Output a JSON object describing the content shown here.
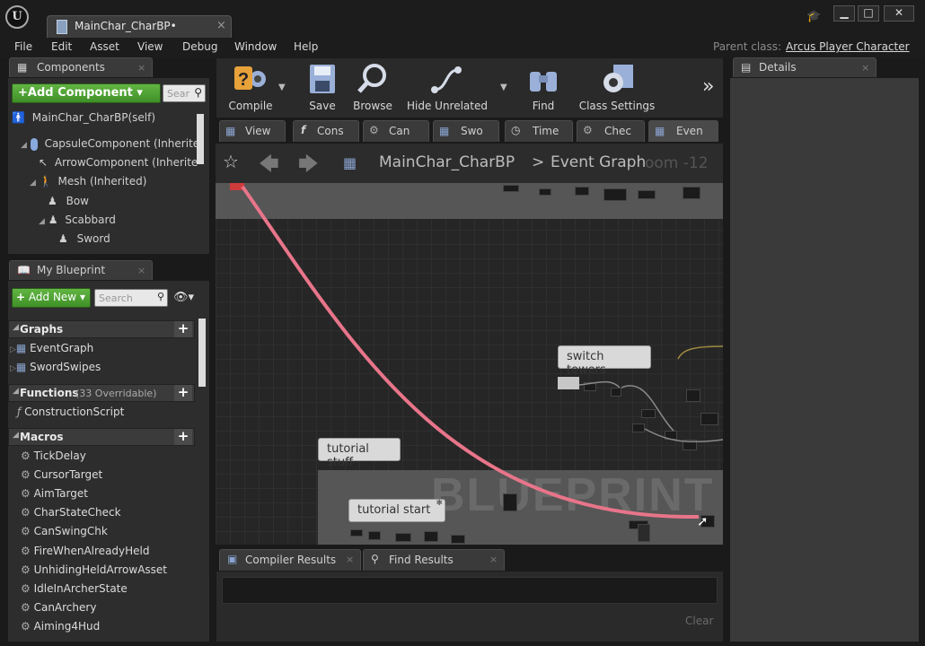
{
  "window": {
    "tab_title": "MainChar_CharBP",
    "tab_modified": "•"
  },
  "menu": [
    "File",
    "Edit",
    "Asset",
    "View",
    "Debug",
    "Window",
    "Help"
  ],
  "parent_class": {
    "label": "Parent class:",
    "value": "Arcus Player Character"
  },
  "components": {
    "tab": "Components",
    "add_button": "+Add Component",
    "search_placeholder": "Sear",
    "tree": [
      "MainChar_CharBP(self)",
      "CapsuleComponent (Inherite",
      "ArrowComponent (Inherite",
      "Mesh (Inherited)",
      "Bow",
      "Scabbard",
      "Sword"
    ]
  },
  "my_blueprint": {
    "tab": "My Blueprint",
    "add_button": "Add New",
    "search_placeholder": "Search",
    "graphs_header": "Graphs",
    "graphs": [
      "EventGraph",
      "SwordSwipes"
    ],
    "functions_header": "Functions",
    "functions_note": "(33 Overridable)",
    "functions": [
      "ConstructionScript"
    ],
    "macros_header": "Macros",
    "macros": [
      "TickDelay",
      "CursorTarget",
      "AimTarget",
      "CharStateCheck",
      "CanSwingChk",
      "FireWhenAlreadyHeld",
      "UnhidingHeldArrowAsset",
      "IdleInArcherState",
      "CanArchery",
      "Aiming4Hud"
    ]
  },
  "toolbar": {
    "compile": "Compile",
    "save": "Save",
    "browse": "Browse",
    "hide_unrelated": "Hide Unrelated",
    "find": "Find",
    "class_settings": "Class Settings"
  },
  "graph_tabs": [
    "View",
    "Cons",
    "Can",
    "Swo",
    "Time",
    "Chec",
    "Even"
  ],
  "breadcrumb": {
    "blueprint": "MainChar_CharBP",
    "separator": ">",
    "graph": "Event Graph",
    "zoom": "oom -12"
  },
  "graph": {
    "comment_switch": "switch towers",
    "comment_tutorial": "tutorial stuff",
    "comment_tutorial_start": "tutorial start",
    "watermark": "BLUEPRINT"
  },
  "details": {
    "tab": "Details"
  },
  "bottom": {
    "compiler_results": "Compiler Results",
    "find_results": "Find Results",
    "clear": "Clear"
  },
  "colors": {
    "accent_green": "#4fa534",
    "wire_pink": "#e8758a"
  }
}
